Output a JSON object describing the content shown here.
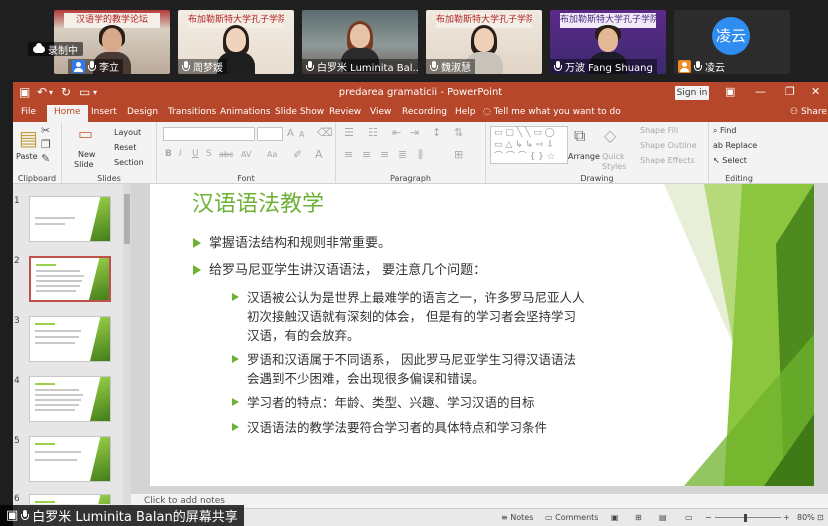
{
  "meeting": {
    "recording_label": "录制中",
    "share_banner": "白罗米 Luminita Balan的屏幕共享",
    "participants": [
      {
        "name": "李立",
        "banner": "汉语学的教学论坛"
      },
      {
        "name": "周梦媛",
        "banner": "布加勒斯特大学孔子学院"
      },
      {
        "name": "白罗米 Luminita Bal...",
        "banner": ""
      },
      {
        "name": "魏淑慧",
        "banner": "布加勒斯特大学孔子学院"
      },
      {
        "name": "万波 Fang Shuang",
        "banner": "布加勒斯特大学孔子学院"
      },
      {
        "name": "凌云",
        "banner": "",
        "avatar_text": "凌云"
      }
    ]
  },
  "ppt": {
    "doc_title": "predarea gramaticii  -  PowerPoint",
    "sign_in": "Sign in",
    "tabs": [
      "File",
      "Home",
      "Insert",
      "Design",
      "Transitions",
      "Animations",
      "Slide Show",
      "Review",
      "View",
      "Recording",
      "Help"
    ],
    "active_tab": "Home",
    "tell_me": "Tell me what you want to do",
    "share": "Share",
    "ribbon": {
      "clipboard": {
        "label": "Clipboard",
        "paste": "Paste"
      },
      "slides": {
        "label": "Slides",
        "new_slide_1": "New",
        "new_slide_2": "Slide",
        "layout": "Layout",
        "reset": "Reset",
        "section": "Section"
      },
      "font": {
        "label": "Font",
        "bold": "B",
        "italic": "I",
        "underline": "U",
        "shadow": "S",
        "strike": "abc",
        "spacing": "AV",
        "case": "Aa",
        "grow": "A",
        "shrink": "A"
      },
      "paragraph": {
        "label": "Paragraph"
      },
      "drawing": {
        "label": "Drawing",
        "arrange": "Arrange",
        "quick_1": "Quick",
        "quick_2": "Styles",
        "shape_fill": "Shape Fill",
        "shape_outline": "Shape Outline",
        "shape_effects": "Shape Effects"
      },
      "editing": {
        "label": "Editing",
        "find": "Find",
        "replace": "Replace",
        "select": "Select"
      }
    },
    "slide_numbers": [
      "1",
      "2",
      "3",
      "4",
      "5",
      "6"
    ],
    "selected_slide": "2",
    "slide": {
      "title": "汉语语法教学",
      "bullets": [
        {
          "level": 1,
          "text": "掌握语法结构和规则非常重要。"
        },
        {
          "level": 1,
          "text": "给罗马尼亚学生讲汉语语法，  要注意几个问题："
        },
        {
          "level": 2,
          "lines": [
            "汉语被公认为是世界上最难学的语言之一，许多罗马尼亚人人",
            "初次接触汉语就有深刻的体会，  但是有的学习者会坚持学习",
            "汉语，有的会放弃。"
          ]
        },
        {
          "level": 2,
          "lines": [
            "罗语和汉语属于不同语系，  因此罗马尼亚学生习得汉语语法",
            "会遇到不少困难，会出现很多偏误和错误。"
          ]
        },
        {
          "level": 2,
          "lines": [
            "学习者的特点：年龄、类型、兴趣、学习汉语的目标"
          ]
        },
        {
          "level": 2,
          "lines": [
            "汉语语法的教学法要符合学习者的具体特点和学习条件"
          ]
        }
      ]
    },
    "notes_placeholder": "Click to add notes",
    "status": {
      "notes": "Notes",
      "comments": "Comments",
      "zoom": "80%"
    }
  }
}
